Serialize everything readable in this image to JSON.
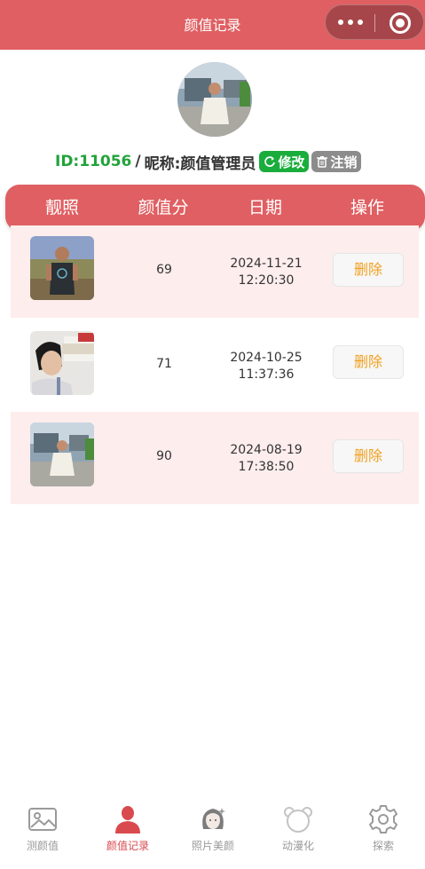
{
  "navbar": {
    "title": "颜值记录",
    "menu_icon": "more-dots-icon",
    "close_icon": "target-icon"
  },
  "profile": {
    "avatar_icon": "user-avatar",
    "id_text": "ID:11056",
    "separator": "/",
    "nick_label": "昵称:",
    "nickname": "颜值管理员",
    "edit_label": "修改",
    "logout_label": "注销"
  },
  "table": {
    "headers": [
      "靓照",
      "颜值分",
      "日期",
      "操作"
    ],
    "rows": [
      {
        "score": "69",
        "date": "2024-11-21",
        "time": "12:20:30",
        "action": "删除"
      },
      {
        "score": "71",
        "date": "2024-10-25",
        "time": "11:37:36",
        "action": "删除"
      },
      {
        "score": "90",
        "date": "2024-08-19",
        "time": "17:38:50",
        "action": "删除"
      }
    ]
  },
  "tabbar": {
    "items": [
      {
        "label": "测颜值",
        "icon": "picture-icon"
      },
      {
        "label": "颜值记录",
        "icon": "person-icon",
        "active": true
      },
      {
        "label": "照片美颜",
        "icon": "girl-face-icon"
      },
      {
        "label": "动漫化",
        "icon": "bear-icon"
      },
      {
        "label": "探索",
        "icon": "gear-icon"
      }
    ]
  },
  "colors": {
    "accent": "#e05f62",
    "green": "#1aad3c",
    "delete": "#f0a020",
    "row_tint": "#fdeded"
  }
}
